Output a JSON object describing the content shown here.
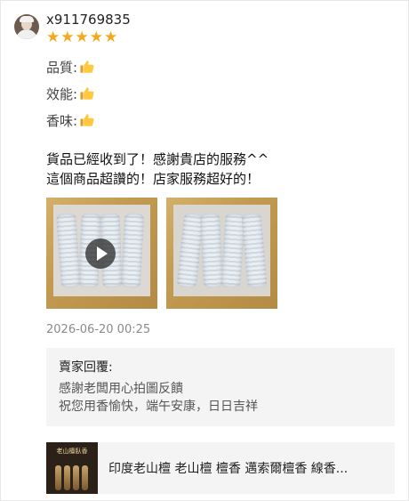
{
  "reviewer": {
    "username": "x911769835",
    "stars": [
      "★",
      "★",
      "★",
      "★",
      "★"
    ]
  },
  "ratings": [
    {
      "label": "品質:"
    },
    {
      "label": "效能:"
    },
    {
      "label": "香味:"
    }
  ],
  "review": {
    "text": "貨品已經收到了！感謝貴店的服務^^\n這個商品超讚的！店家服務超好的！"
  },
  "timestamp": "2026-06-20 00:25",
  "seller_reply": {
    "title": "賣家回覆:",
    "text": "感謝老闆用心拍圖反饋\n祝您用香愉快，端午安康，日日吉祥"
  },
  "product": {
    "thumb_text": "老山檀臥香",
    "title": "印度老山檀 老山檀 檀香 邁索爾檀香 線香..."
  },
  "colors": {
    "star": "#f6a81a",
    "panel_bg": "#f4f4f4",
    "timestamp": "#8a8a8a"
  },
  "icons": {
    "thumb_up": "thumbs-up-icon",
    "play": "play-icon"
  }
}
